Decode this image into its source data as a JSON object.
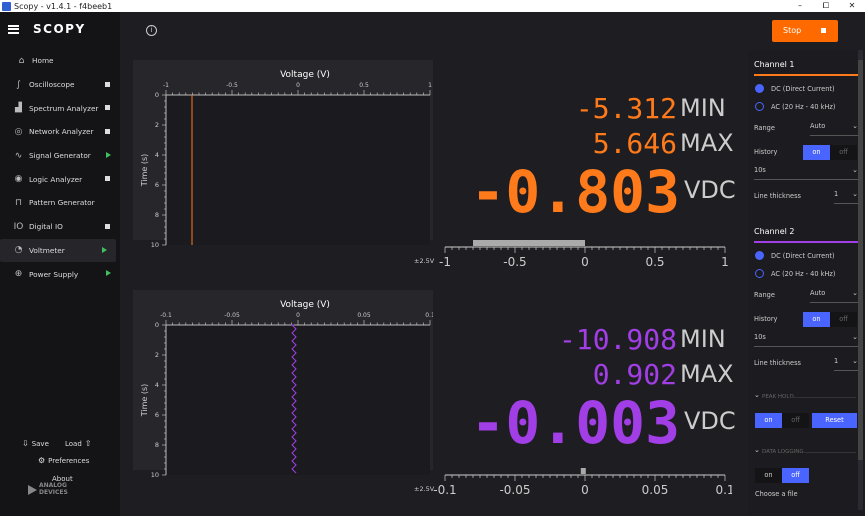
{
  "window": {
    "title": "Scopy - v1.4.1 - f4beeb1",
    "min": "–",
    "max": "⧠",
    "close": "✕"
  },
  "brand": {
    "name": "SCOPY"
  },
  "sidebar": {
    "home": "Home",
    "items": [
      {
        "label": "Oscilloscope",
        "icon": "oscilloscope-icon",
        "glyph": "∫",
        "state": "stopped"
      },
      {
        "label": "Spectrum Analyzer",
        "icon": "spectrum-analyzer-icon",
        "glyph": "▟",
        "state": "stopped"
      },
      {
        "label": "Network Analyzer",
        "icon": "network-analyzer-icon",
        "glyph": "◎",
        "state": "stopped"
      },
      {
        "label": "Signal Generator",
        "icon": "signal-generator-icon",
        "glyph": "∿",
        "state": "running"
      },
      {
        "label": "Logic Analyzer",
        "icon": "logic-analyzer-icon",
        "glyph": "◉",
        "state": "stopped"
      },
      {
        "label": "Pattern Generator",
        "icon": "pattern-generator-icon",
        "glyph": "⊓",
        "state": "none"
      },
      {
        "label": "Digital IO",
        "icon": "digital-io-icon",
        "glyph": "IO",
        "state": "stopped"
      },
      {
        "label": "Voltmeter",
        "icon": "voltmeter-icon",
        "glyph": "◔",
        "state": "running",
        "active": true
      },
      {
        "label": "Power Supply",
        "icon": "power-supply-icon",
        "glyph": "⊕",
        "state": "running"
      }
    ],
    "save": "Save",
    "load": "Load",
    "preferences": "Preferences",
    "about": "About",
    "logo_text": [
      "ANALOG",
      "DEVICES"
    ]
  },
  "toolbar": {
    "stop_label": "Stop"
  },
  "channels": [
    {
      "color": "#ff7a1a",
      "plot": {
        "title": "Voltage (V)",
        "ylabel": "Time (s)",
        "xticks": [
          "-1",
          "-0.5",
          "0",
          "0.5",
          "1"
        ],
        "yticks": [
          "0",
          "2",
          "4",
          "6",
          "8",
          "10"
        ],
        "trace_value": -0.803
      },
      "min_value": "-5.312",
      "min_label": "MIN",
      "max_value": "5.646",
      "max_label": "MAX",
      "value": "-0.803",
      "unit": "VDC",
      "scale": {
        "range_label": "±2.5V",
        "ticks": [
          "-1",
          "-0.5",
          "0",
          "0.5",
          "1"
        ],
        "bar_from": -0.8,
        "bar_to": 0
      }
    },
    {
      "color": "#a23ee6",
      "plot": {
        "title": "Voltage (V)",
        "ylabel": "Time (s)",
        "xticks": [
          "-0.1",
          "-0.05",
          "0",
          "0.05",
          "0.1"
        ],
        "yticks": [
          "0",
          "2",
          "4",
          "6",
          "8",
          "10"
        ],
        "trace_value": -0.003
      },
      "min_value": "-10.908",
      "min_label": "MIN",
      "max_value": "0.902",
      "max_label": "MAX",
      "value": "-0.003",
      "unit": "VDC",
      "scale": {
        "range_label": "±2.5V",
        "ticks": [
          "-0.1",
          "-0.05",
          "0",
          "0.05",
          "0.1"
        ],
        "bar_from": -0.003,
        "bar_to": 0
      }
    }
  ],
  "settings": {
    "accent": "#4a64ff",
    "channel1": {
      "title": "Channel 1",
      "dc": "DC (Direct Current)",
      "ac": "AC (20 Hz - 40 kHz)",
      "range_label": "Range",
      "range_value": "Auto",
      "history_label": "History",
      "history_on": "on",
      "history_off": "off",
      "history_value": "10s",
      "thickness_label": "Line thickness",
      "thickness_value": "1"
    },
    "channel2": {
      "title": "Channel 2",
      "dc": "DC (Direct Current)",
      "ac": "AC (20 Hz - 40 kHz)",
      "range_label": "Range",
      "range_value": "Auto",
      "history_label": "History",
      "history_on": "on",
      "history_off": "off",
      "history_value": "10s",
      "thickness_label": "Line thickness",
      "thickness_value": "1"
    },
    "peak_hold": {
      "title": "PEAK HOLD",
      "on": "on",
      "off": "off",
      "reset": "Reset"
    },
    "data_logging": {
      "title": "DATA LOGGING",
      "on": "on",
      "off": "off",
      "choose_file": "Choose a file"
    }
  }
}
